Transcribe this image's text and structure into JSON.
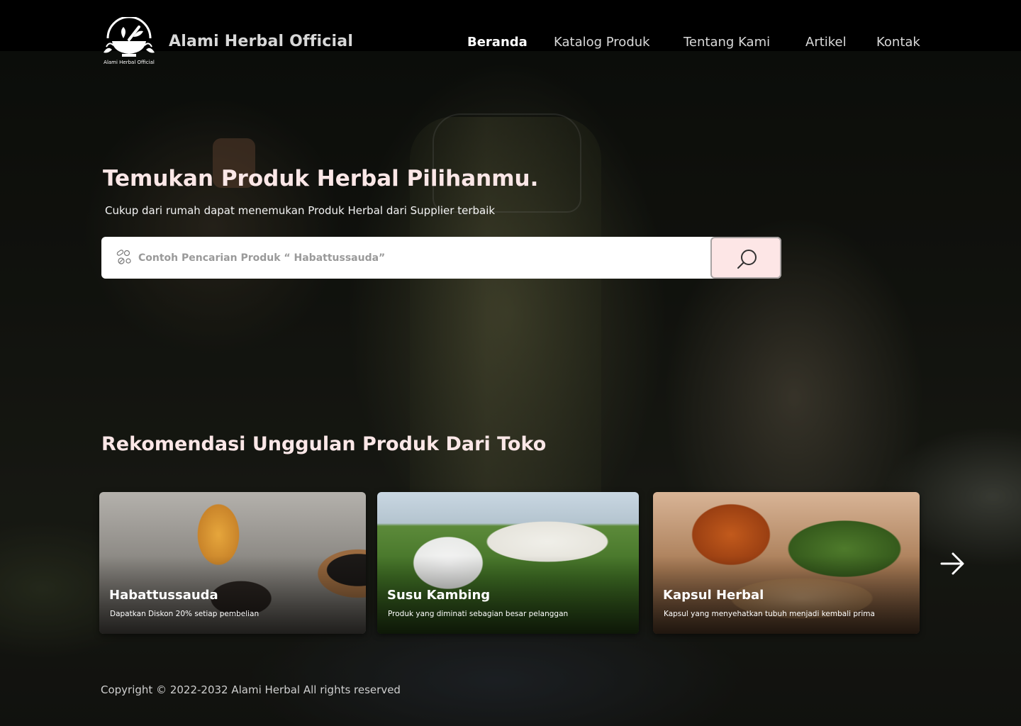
{
  "header": {
    "logo_caption": "Alami Herbal Official",
    "brand": "Alami Herbal Official",
    "nav": [
      {
        "label": "Beranda",
        "active": true
      },
      {
        "label": "Katalog Produk",
        "active": false
      },
      {
        "label": "Tentang Kami",
        "active": false
      },
      {
        "label": "Artikel",
        "active": false
      },
      {
        "label": "Kontak",
        "active": false
      }
    ]
  },
  "hero": {
    "title": "Temukan Produk Herbal Pilihanmu.",
    "subtitle": "Cukup dari rumah dapat menemukan Produk Herbal dari Supplier terbaik",
    "search": {
      "placeholder": "Contoh Pencarian Produk “ Habattussauda”",
      "leading_icon": "pills-icon",
      "button_icon": "search-icon"
    }
  },
  "recommendations": {
    "title": "Rekomendasi Unggulan Produk Dari Toko",
    "cards": [
      {
        "title": "Habattussauda",
        "description": "Dapatkan Diskon 20% setiap pembelian"
      },
      {
        "title": "Susu Kambing",
        "description": "Produk yang diminati sebagian besar pelanggan"
      },
      {
        "title": "Kapsul Herbal",
        "description": "Kapsul yang menyehatkan tubuh menjadi kembali prima"
      }
    ],
    "next_icon": "arrow-right-icon"
  },
  "footer": {
    "copyright": "Copyright © 2022-2032 Alami Herbal All rights reserved"
  },
  "colors": {
    "heading": "#fbe7e7",
    "search_button_bg": "#fde6e6",
    "top_bar": "#000000"
  }
}
